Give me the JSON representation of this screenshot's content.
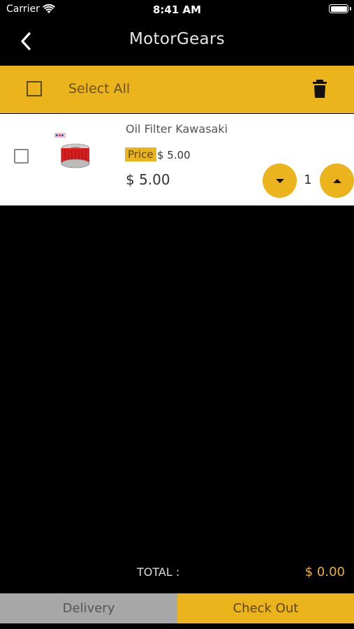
{
  "status_bar": {
    "carrier": "Carrier",
    "time": "8:41 AM",
    "icons": [
      "wifi-icon",
      "battery-icon"
    ]
  },
  "nav": {
    "title": "MotorGears",
    "back_icon": "chevron-left-icon"
  },
  "select_bar": {
    "label": "Select All",
    "checked": false,
    "delete_icon": "trash-icon"
  },
  "cart": {
    "items": [
      {
        "name": "Oil Filter Kawasaki",
        "price_badge": "Price",
        "price": "$ 5.00",
        "line_total": "$ 5.00",
        "quantity": "1",
        "checked": false,
        "image_icon": "oil-filter-image"
      }
    ]
  },
  "summary": {
    "total_label": "TOTAL :",
    "total_value": "$ 0.00"
  },
  "footer": {
    "delivery_label": "Delivery",
    "checkout_label": "Check Out"
  },
  "colors": {
    "accent": "#EBB31C",
    "background": "#000000",
    "row_background": "#FFFFFF",
    "disabled_button": "#A7A7A7"
  }
}
